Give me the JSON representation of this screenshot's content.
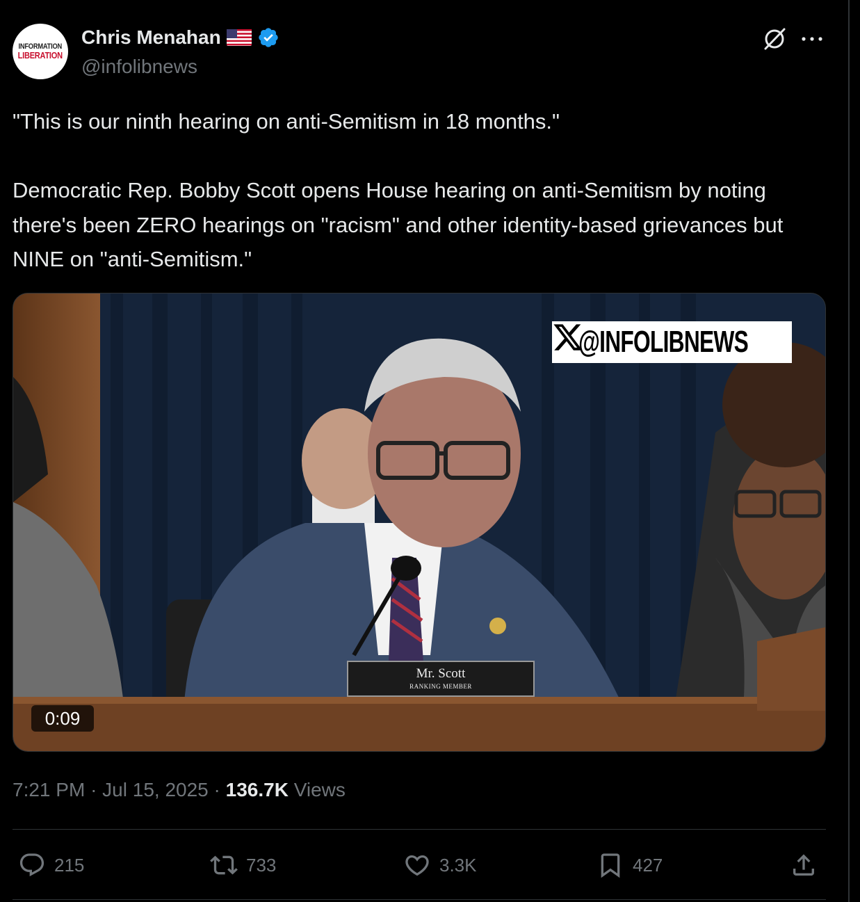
{
  "author": {
    "avatar_line1": "INFORMATION",
    "avatar_line2": "LIBERATION",
    "display_name": "Chris Menahan",
    "flag_icon": "us-flag-icon",
    "verified_icon": "verified-badge-icon",
    "handle": "@infolibnews"
  },
  "header_actions": {
    "grok_icon": "grok-icon",
    "more_icon": "more-icon",
    "more_label": "···"
  },
  "tweet": {
    "text": "\"This is our ninth hearing on anti-Semitism in 18 months.\"\n\nDemocratic Rep. Bobby Scott opens House hearing on anti-Semitism by noting there's been ZERO hearings on \"racism\" and other identity-based grievances but NINE on \"anti-Semitism.\""
  },
  "media": {
    "watermark_icon": "x-logo-icon",
    "watermark_text": "@INFOLIBNEWS",
    "nameplate_title": "Mr. Scott",
    "nameplate_subtitle": "RANKING MEMBER",
    "duration": "0:09"
  },
  "meta": {
    "time": "7:21 PM",
    "separator": "·",
    "date": "Jul 15, 2025",
    "views_count": "136.7K",
    "views_label": "Views"
  },
  "actions": {
    "replies": "215",
    "reposts": "733",
    "likes": "3.3K",
    "bookmarks": "427"
  },
  "colors": {
    "background": "#000000",
    "text": "#e7e9ea",
    "secondary": "#71767b",
    "verified": "#1d9bf0",
    "border": "#2f3336"
  }
}
